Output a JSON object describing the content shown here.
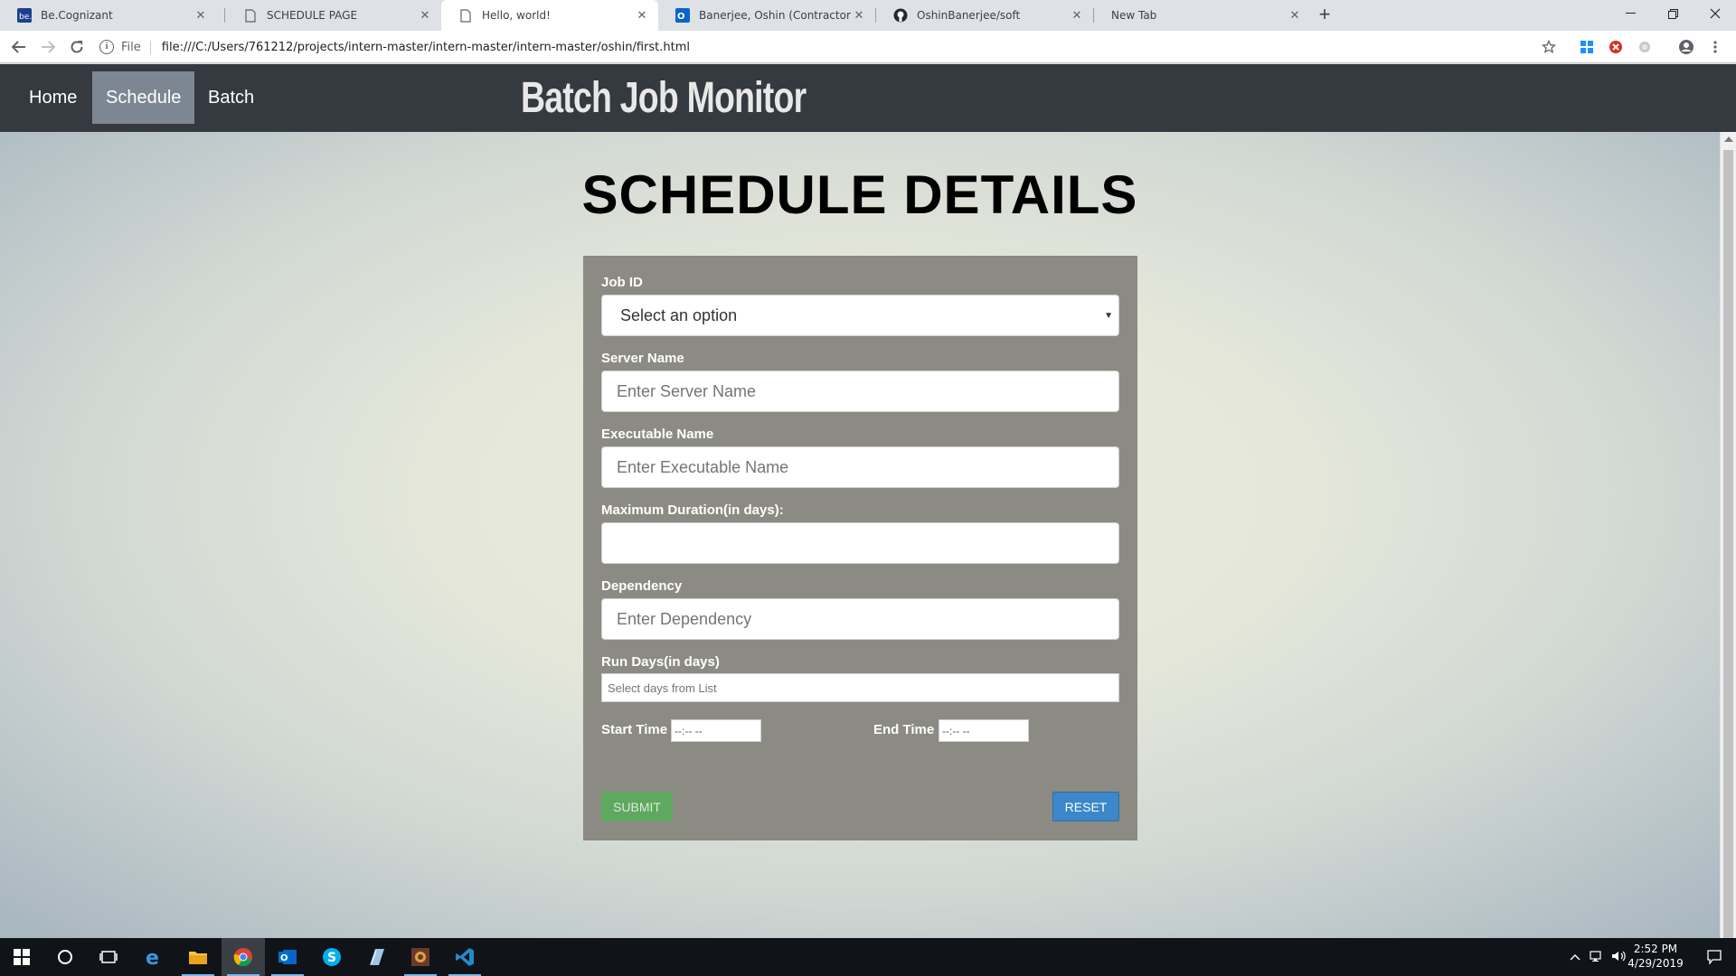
{
  "browser": {
    "tabs": [
      {
        "title": "Be.Cognizant",
        "icon": "cognizant-icon",
        "active": false
      },
      {
        "title": "SCHEDULE PAGE",
        "icon": "document-icon",
        "active": false
      },
      {
        "title": "Hello, world!",
        "icon": "document-icon",
        "active": true
      },
      {
        "title": "Banerjee, Oshin (Contractor) - Ou",
        "icon": "outlook-icon",
        "active": false
      },
      {
        "title": "OshinBanerjee/soft",
        "icon": "github-icon",
        "active": false
      },
      {
        "title": "New Tab",
        "icon": "",
        "active": false
      }
    ],
    "address": {
      "scheme_label": "File",
      "url": "file:///C:/Users/761212/projects/intern-master/intern-master/intern-master/oshin/first.html"
    }
  },
  "site": {
    "nav": [
      {
        "label": "Home",
        "active": false
      },
      {
        "label": "Schedule",
        "active": true
      },
      {
        "label": "Batch",
        "active": false
      }
    ],
    "brand": "Batch Job Monitor"
  },
  "page": {
    "heading": "SCHEDULE DETAILS",
    "form": {
      "job_id": {
        "label": "Job ID",
        "value": "Select an option"
      },
      "server_name": {
        "label": "Server Name",
        "placeholder": "Enter Server Name"
      },
      "executable_name": {
        "label": "Executable Name",
        "placeholder": "Enter Executable Name"
      },
      "max_duration": {
        "label": "Maximum Duration(in days):",
        "value": ""
      },
      "dependency": {
        "label": "Dependency",
        "placeholder": "Enter Dependency"
      },
      "run_days": {
        "label": "Run Days(in days)",
        "placeholder": "Select days from List"
      },
      "start_time": {
        "label": "Start Time",
        "value": "--:-- --"
      },
      "end_time": {
        "label": "End Time",
        "value": "--:-- --"
      },
      "submit_label": "SUBMIT",
      "reset_label": "RESET"
    }
  },
  "taskbar": {
    "apps": [
      "windows-start-icon",
      "cortana-search-icon",
      "task-view-icon",
      "edge-icon",
      "file-explorer-icon",
      "chrome-icon",
      "outlook-icon",
      "skype-icon",
      "notepad-icon",
      "game-icon",
      "vscode-icon"
    ],
    "time": "2:52 PM",
    "date": "4/29/2019"
  },
  "colors": {
    "nav_bg": "#343a40",
    "nav_active": "#7c8793",
    "panel_bg": "#8c8b83",
    "submit": "#5fa85f",
    "reset": "#3b87c9"
  }
}
